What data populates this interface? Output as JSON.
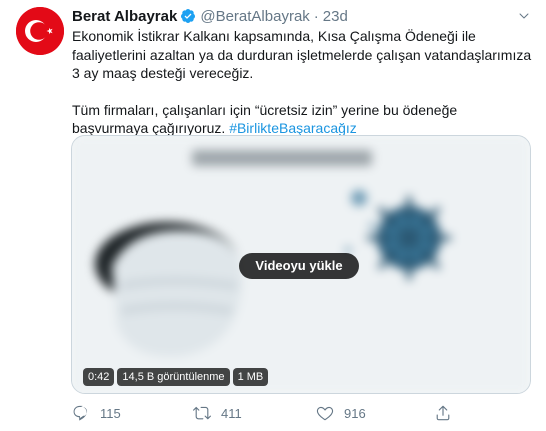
{
  "tweet": {
    "author_name": "Berat Albayrak",
    "handle": "@BeratAlbayrak",
    "separator": "·",
    "time": "23d",
    "text_p1": "Ekonomik İstikrar Kalkanı kapsamında, Kısa Çalışma Ödeneği ile faaliyetlerini azaltan ya da durduran işletmelerde çalışan vatandaşlarımıza 3 ay maaş desteği vereceğiz.",
    "text_p2": "Tüm firmaları, çalışanları için “ücretsiz izin” yerine bu ödeneğe başvurmaya çağırıyoruz.",
    "hashtag": "#BirlikteBaşaracağız",
    "avatar_colors": {
      "background": "#e30a17",
      "symbol": "#ffffff"
    },
    "verified_color": "#1da1f2",
    "hashtag_color": "#1b95e0"
  },
  "media": {
    "load_label": "Videoyu yükle",
    "duration": "0:42",
    "views": "14,5 B görüntülenme",
    "size": "1 MB"
  },
  "actions": {
    "reply_count": "115",
    "retweet_count": "411",
    "like_count": "916",
    "icons": [
      "reply-icon",
      "retweet-icon",
      "heart-icon",
      "share-icon"
    ]
  }
}
